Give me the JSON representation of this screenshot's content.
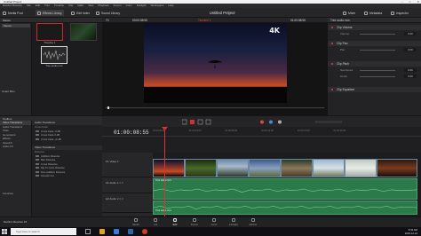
{
  "window": {
    "title": "Untitled Project",
    "controls": [
      "–",
      "□",
      "✕"
    ]
  },
  "menu": [
    "DaVinci Resolve",
    "File",
    "Edit",
    "Trim",
    "Timeline",
    "Clip",
    "Mark",
    "View",
    "Playback",
    "Fusion",
    "Color",
    "Fairlight",
    "Workspace",
    "Help"
  ],
  "toolbar": {
    "media_pool": "Media Pool",
    "effects": "Effects Library",
    "edit_index": "Edit Index",
    "sound_library": "Sound Library",
    "project_title": "Untitled Project",
    "edited": "Edited",
    "mixer": "Mixer",
    "metadata": "Metadata",
    "inspector": "Inspector"
  },
  "media_pool": {
    "master": "Master",
    "smart_bins": "Smart Bins",
    "clips": [
      {
        "name": "Timeline 1"
      },
      {
        "name": ""
      },
      {
        "name": "Tree audio.mov"
      }
    ]
  },
  "viewer": {
    "fit": "Fit",
    "timeline_name": "Timeline 1",
    "watermark": "4K",
    "tc_left": "00:00:08:55",
    "tc_right": "01:00:08:55"
  },
  "inspector": {
    "title": "Tree audio.mov",
    "sections": [
      {
        "title": "Clip Volume",
        "rows": [
          {
            "label": "Volume",
            "value": "0.00"
          }
        ]
      },
      {
        "title": "Clip Pan",
        "rows": [
          {
            "label": "Pan",
            "value": "0.00"
          }
        ]
      },
      {
        "title": "Clip Pitch",
        "rows": [
          {
            "label": "Semitones",
            "value": "0.00"
          },
          {
            "label": "Cents",
            "value": "0.00"
          }
        ]
      },
      {
        "title": "Clip Equalizer",
        "rows": []
      }
    ]
  },
  "effects": {
    "toolbox": "Toolbox",
    "audio_transitions": "Audio Transitions",
    "cross_fade": "Cross Fade",
    "cross_fade_items": [
      "Cross Fade -3 dB",
      "Cross Fade 0 dB",
      "Cross Fade +3 dB"
    ],
    "video_transitions": "Video Transitions",
    "dissolve": "Dissolve",
    "video_items": [
      "Additive Dissolve",
      "Blur Dissolve",
      "Cross Dissolve",
      "Dip To Color Dissolve",
      "Non-Additive Dissolve",
      "Smooth Cut"
    ],
    "left_items": [
      "Video Transitions",
      "Audio Transitions",
      "Titles",
      "Generators",
      "Effects"
    ],
    "openfx": "OpenFX",
    "audio_fx": "Audio FX",
    "favorites": "Favorites"
  },
  "timeline": {
    "timecode": "01:00:08:55",
    "ruler_marks": [
      "01:00:00:00",
      "01:00:04:00",
      "01:00:08:00",
      "01:00:12:00",
      "01:00:16:00",
      "01:00:20:00"
    ],
    "tracks": [
      {
        "id": "V1",
        "name": "Video 1"
      },
      {
        "id": "A1",
        "name": "Audio 1",
        "level": "2.0"
      },
      {
        "id": "A2",
        "name": "Audio 2",
        "level": "2.0"
      }
    ],
    "audio_clip_a1": "Tree audio.mov",
    "audio_clip_a2": "Tree audio.mov"
  },
  "pages": [
    "Media",
    "Cut",
    "Edit",
    "Fusion",
    "Color",
    "Fairlight",
    "Deliver"
  ],
  "active_page": "Edit",
  "app_brand": "DaVinci Resolve 15",
  "taskbar": {
    "search_placeholder": "Type here to search",
    "time": "8:32 AM",
    "date": "2018-12-24"
  }
}
